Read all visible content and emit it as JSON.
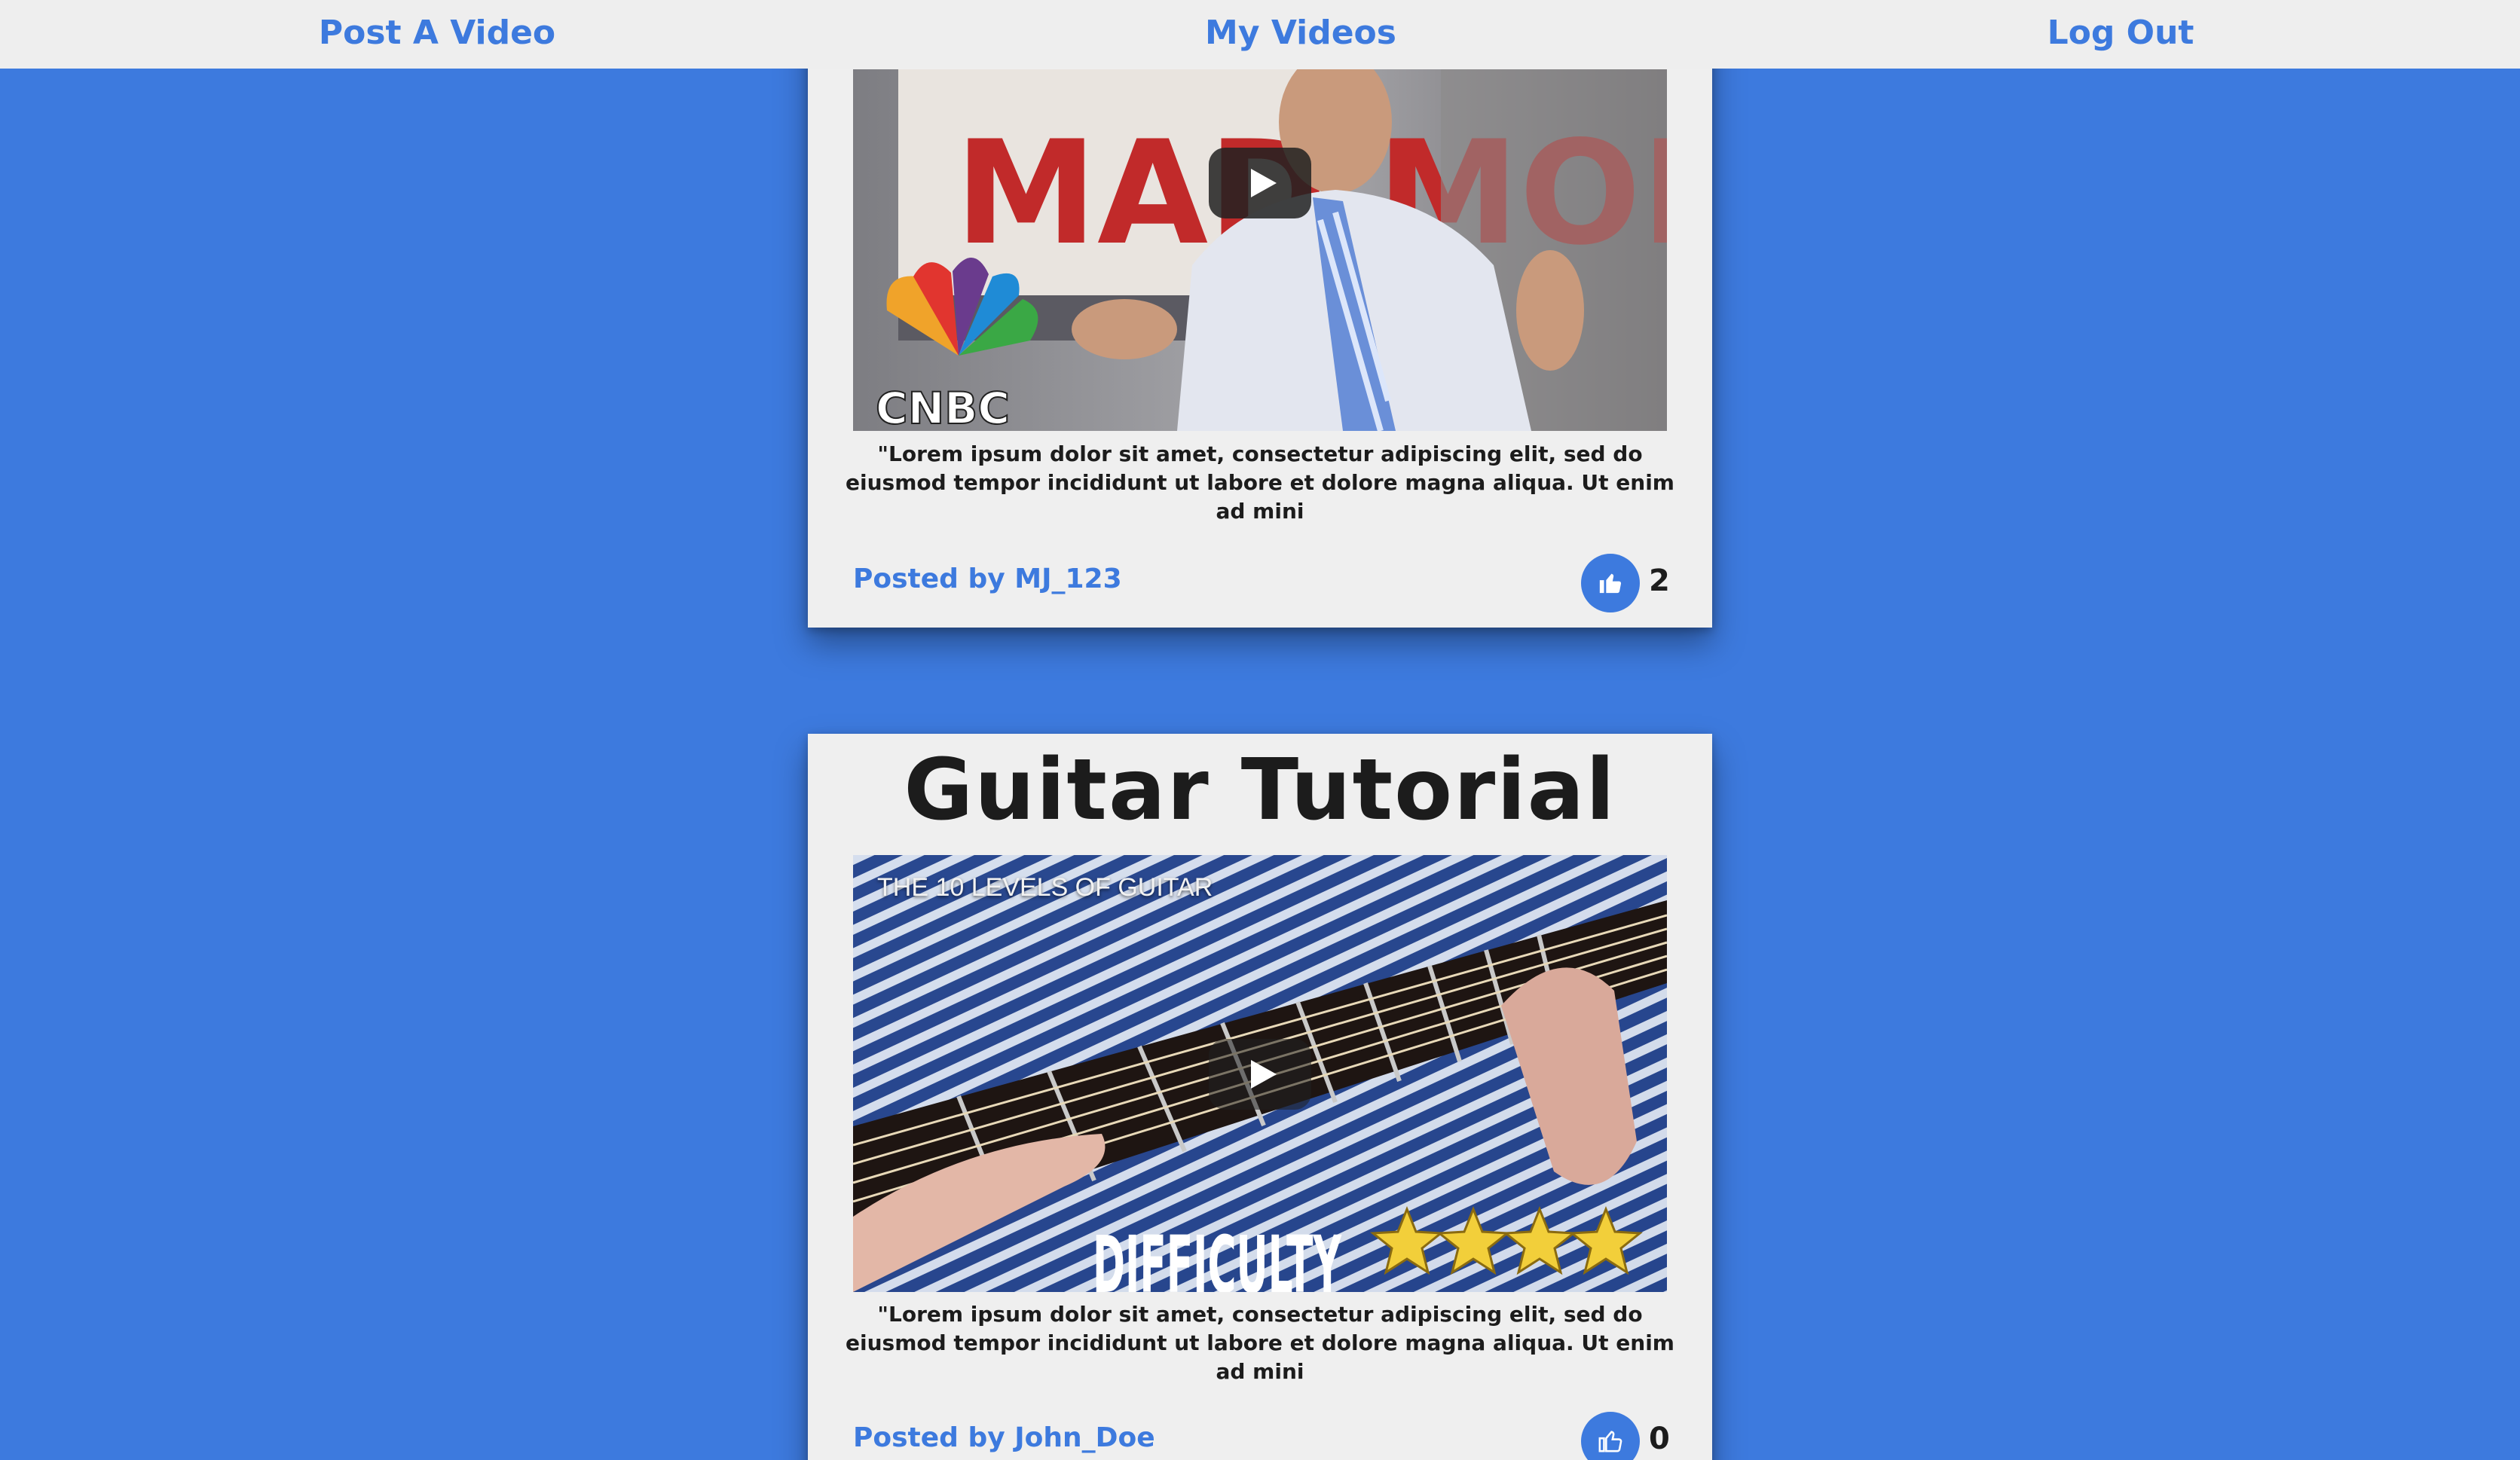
{
  "nav": {
    "post_label": "Post A Video",
    "my_videos_label": "My Videos",
    "logout_label": "Log Out"
  },
  "posts": [
    {
      "title": "",
      "video_brand_text": "CNBC",
      "video_sign_text": "MAD MONEY",
      "description": "\"Lorem ipsum dolor sit amet, consectetur adipiscing elit, sed do eiusmod tempor incididunt ut labore et dolore magna aliqua. Ut enim ad mini",
      "posted_by_prefix": "Posted by",
      "author": "MJ_123",
      "likes": "2",
      "liked": true
    },
    {
      "title": "Guitar Tutorial",
      "video_overlay_title": "THE 10 LEVELS OF GUITAR",
      "video_caption": "DIFFICULTY",
      "video_stars": 4,
      "description": "\"Lorem ipsum dolor sit amet, consectetur adipiscing elit, sed do eiusmod tempor incididunt ut labore et dolore magna aliqua. Ut enim ad mini",
      "posted_by_prefix": "Posted by",
      "author": "John_Doe",
      "likes": "0",
      "liked": false
    }
  ],
  "colors": {
    "accent": "#3d7ade",
    "card_bg": "#efefef",
    "nav_bg": "#eeeeee",
    "text": "#1c1c1c"
  }
}
